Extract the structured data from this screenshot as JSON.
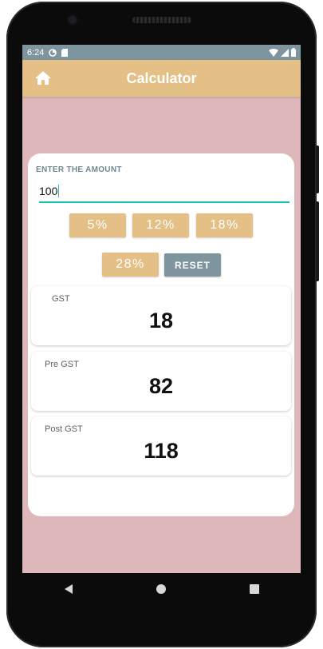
{
  "status_bar": {
    "time": "6:24",
    "left_icons": [
      "data-saver-icon",
      "sd-card-icon"
    ],
    "right_icons": [
      "wifi-icon",
      "cell-signal-icon",
      "battery-icon"
    ]
  },
  "app_bar": {
    "title": "Calculator",
    "home_icon": "home-icon",
    "color": "#e4bf86"
  },
  "form": {
    "amount_label": "ENTER THE AMOUNT",
    "amount_value": "100",
    "rate_buttons": [
      "5%",
      "12%",
      "18%",
      "28%"
    ],
    "reset_label": "RESET"
  },
  "results": [
    {
      "label": "GST",
      "value": "18"
    },
    {
      "label": "Pre GST",
      "value": "82"
    },
    {
      "label": "Post GST",
      "value": "118"
    }
  ],
  "nav": {
    "back_icon": "back-triangle-icon",
    "home_icon": "home-circle-icon",
    "recents_icon": "recents-square-icon"
  },
  "colors": {
    "background": "#ddb7b9",
    "accent": "#e4bf86",
    "status_bar": "#7e959f",
    "input_underline": "#19bfb7",
    "reset_button": "#7e959f"
  }
}
